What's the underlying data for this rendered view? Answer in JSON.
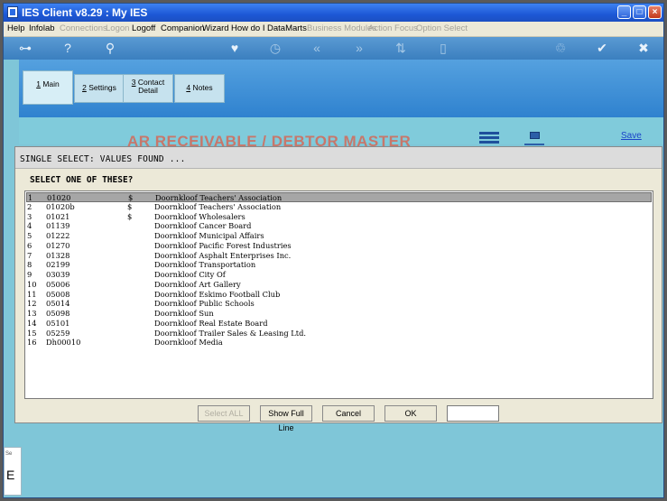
{
  "window": {
    "title": "IES Client v8.29 : My IES",
    "min": "_",
    "max": "□",
    "close": "×"
  },
  "menu": [
    {
      "label": "Help",
      "enabled": true
    },
    {
      "label": "Infolab",
      "enabled": true
    },
    {
      "label": "Connections",
      "enabled": false
    },
    {
      "label": "Logon",
      "enabled": false
    },
    {
      "label": "Logoff",
      "enabled": true
    },
    {
      "label": "Companion",
      "enabled": true
    },
    {
      "label": "Wizard",
      "enabled": true
    },
    {
      "label": "How do I",
      "enabled": true
    },
    {
      "label": "DataMarts",
      "enabled": true
    },
    {
      "label": "Business Modules",
      "enabled": false
    },
    {
      "label": "Action Focus",
      "enabled": false
    },
    {
      "label": "Option Select",
      "enabled": false
    }
  ],
  "toolbar": {
    "icons": [
      "key-icon",
      "help-icon",
      "search-icon",
      "heart-icon",
      "clock-icon",
      "back-icon",
      "forward-icon",
      "sort-icon",
      "page-icon",
      "recycle-icon",
      "check-icon",
      "close-icon"
    ],
    "glyphs": {
      "key": "⊶",
      "help": "?",
      "search": "⚲",
      "heart": "♥",
      "clock": "◷",
      "back": "«",
      "forward": "»",
      "sort": "⇅",
      "page": "▯",
      "recycle": "♲",
      "check": "✔",
      "close": "✖"
    }
  },
  "tabs": [
    {
      "key": "1",
      "label": "Main"
    },
    {
      "key": "2",
      "label": "Settings"
    },
    {
      "key": "3",
      "label": "Contact",
      "label2": "Detail"
    },
    {
      "key": "4",
      "label": "Notes"
    }
  ],
  "header": {
    "title": "AR RECEIVABLE / DEBTOR MASTER",
    "save": "Save"
  },
  "dialog": {
    "title": "SINGLE SELECT: VALUES FOUND ...",
    "prompt": "SELECT ONE OF THESE?",
    "rows": [
      {
        "n": "1",
        "code": "01020",
        "flag": "$",
        "name": "Doornkloof Teachers' Association"
      },
      {
        "n": "2",
        "code": "01020b",
        "flag": "$",
        "name": "Doornkloof Teachers' Association"
      },
      {
        "n": "3",
        "code": "01021",
        "flag": "$",
        "name": "Doornkloof Wholesalers"
      },
      {
        "n": "4",
        "code": "01139",
        "flag": "",
        "name": "Doornkloof Cancer Board"
      },
      {
        "n": "5",
        "code": "01222",
        "flag": "",
        "name": "Doornkloof Municipal Affairs"
      },
      {
        "n": "6",
        "code": "01270",
        "flag": "",
        "name": "Doornkloof Pacific Forest Industries"
      },
      {
        "n": "7",
        "code": "01328",
        "flag": "",
        "name": "Doornkloof Asphalt Enterprises Inc."
      },
      {
        "n": "8",
        "code": "02199",
        "flag": "",
        "name": "Doornkloof Transportation"
      },
      {
        "n": "9",
        "code": "03039",
        "flag": "",
        "name": "Doornkloof City Of"
      },
      {
        "n": "10",
        "code": "05006",
        "flag": "",
        "name": "Doornkloof Art Gallery"
      },
      {
        "n": "11",
        "code": "05008",
        "flag": "",
        "name": "Doornkloof Eskimo Football Club"
      },
      {
        "n": "12",
        "code": "05014",
        "flag": "",
        "name": "Doornkloof Public Schools"
      },
      {
        "n": "13",
        "code": "05098",
        "flag": "",
        "name": "Doornkloof Sun"
      },
      {
        "n": "14",
        "code": "05101",
        "flag": "",
        "name": "Doornkloof Real Estate Board"
      },
      {
        "n": "15",
        "code": "05259",
        "flag": "",
        "name": "Doornkloof Trailer Sales & Leasing Ltd."
      },
      {
        "n": "16",
        "code": "Dh00010",
        "flag": "",
        "name": "Doornkloof Media"
      }
    ],
    "selected_index": 0,
    "buttons": {
      "select_all": "Select ALL",
      "show_full_line": "Show Full Line",
      "cancel": "Cancel",
      "ok": "OK"
    },
    "input_value": ""
  },
  "lower": {
    "letter": "E",
    "mini": "Se"
  }
}
